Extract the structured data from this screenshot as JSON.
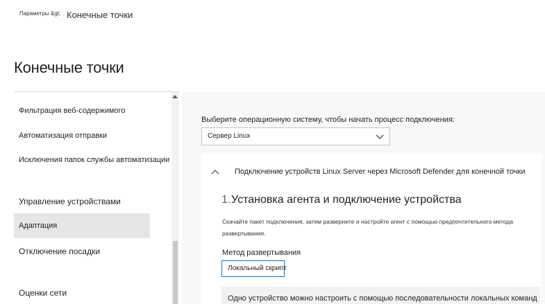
{
  "breadcrumb": {
    "root": "Параметры &gt;",
    "current": "Конечные точки"
  },
  "page_title": "Конечные точки",
  "sidebar": {
    "items": [
      {
        "label": "Фильтрация веб-содержимого"
      },
      {
        "label": "Автоматизация отправки"
      },
      {
        "label": "Исключения папок службы автоматизации"
      },
      {
        "label": "Управление устройствами"
      },
      {
        "label": "Адаптация",
        "selected": true
      },
      {
        "label": "Отключение посадки"
      },
      {
        "label": "Оценки сети"
      }
    ]
  },
  "main": {
    "os_prompt": "Выберите операционную систему, чтобы начать процесс подключения:",
    "os_selected": "Сервер Linux",
    "section_title": "Подключение устройств Linux Server через Microsoft Defender для конечной точки",
    "step": {
      "number": "1.",
      "title": "Установка агента и подключение устройства",
      "description": "Скачайте пакет подключения, затем разверните и настройте агент с помощью предпочтительного метода развертывания."
    },
    "method_label": "Метод развертывания",
    "method_value": "Локальный скрипт",
    "info_text": "Одно устройство можно настроить с помощью последовательности локальных команд"
  },
  "icons": {
    "select_chevron": "chevron-down-icon",
    "section_chevron": "chevron-up-icon",
    "scroll_up": "arrow-up-icon"
  },
  "colors": {
    "accent": "#0078d4",
    "selected_nav": "#e6e6e6",
    "content_bg": "#f8f8f8"
  }
}
